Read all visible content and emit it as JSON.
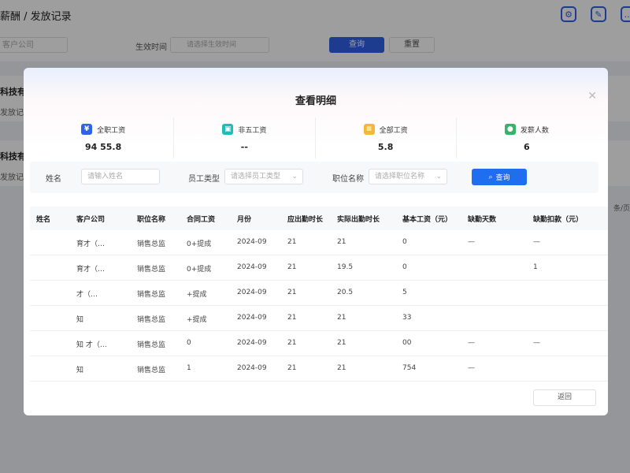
{
  "page": {
    "breadcrumb": "薪酬 / 发放记录",
    "company_placeholder": "客户公司",
    "date_label": "生效时间",
    "date_placeholder": "请选择生效时间",
    "query_label": "查询",
    "reset_label": "重置",
    "cards": [
      {
        "title": "科技有",
        "sub": "发放记"
      },
      {
        "title": "科技有",
        "sub": "发放记"
      }
    ],
    "pager": "条/页",
    "colors": {
      "primary": "#2f62e8",
      "button": "#1f6ef0"
    }
  },
  "modal": {
    "title": "查看明细",
    "close_icon": "close-icon",
    "stats": [
      {
        "label": "全职工资",
        "value": "94  55.8",
        "icon": "yen-icon",
        "color": "#2f62e8"
      },
      {
        "label": "非五工资",
        "value": "--",
        "icon": "wallet-icon",
        "color": "#1bbfb8"
      },
      {
        "label": "全部工资",
        "value": "5.8",
        "icon": "document-icon",
        "color": "#f5b63a"
      },
      {
        "label": "发薪人数",
        "value": "6",
        "icon": "user-icon",
        "color": "#36b36b"
      }
    ],
    "search": {
      "name_label": "姓名",
      "name_placeholder": "请输入姓名",
      "type_label": "员工类型",
      "type_placeholder": "请选择员工类型",
      "position_label": "职位名称",
      "position_placeholder": "请选择职位名称",
      "query_label": "查询"
    },
    "table": {
      "headers": [
        "姓名",
        "客户公司",
        "职位名称",
        "合同工资",
        "月份",
        "应出勤时长",
        "实际出勤时长",
        "基本工资（元）",
        "缺勤天数",
        "缺勤扣款（元）"
      ],
      "rows": [
        [
          "",
          "育才（…",
          "销售总监",
          "0+提成",
          "2024-09",
          "21",
          "21",
          "0",
          "—",
          "—"
        ],
        [
          "",
          "育才（…",
          "销售总监",
          "0+提成",
          "2024-09",
          "21",
          "19.5",
          "0",
          "",
          "1"
        ],
        [
          "",
          "才（…",
          "销售总监",
          "+提成",
          "2024-09",
          "21",
          "20.5",
          "5",
          "",
          ""
        ],
        [
          "",
          "知",
          "销售总监",
          "+提成",
          "2024-09",
          "21",
          "21",
          "33",
          "",
          ""
        ],
        [
          "",
          "知 才（…",
          "销售总监",
          "0",
          "2024-09",
          "21",
          "21",
          "00",
          "—",
          "—"
        ],
        [
          "",
          "知",
          "销售总监",
          "1",
          "2024-09",
          "21",
          "21",
          "754",
          "—",
          ""
        ]
      ]
    },
    "return_label": "返回"
  }
}
